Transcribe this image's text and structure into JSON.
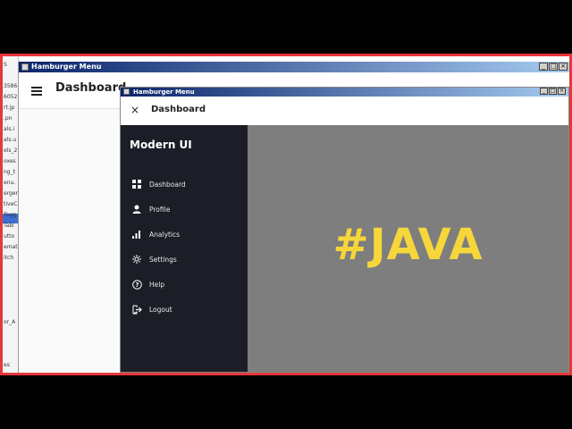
{
  "back_window": {
    "title": "Hamburger Menu",
    "header_title": "Dashboard",
    "controls": {
      "minimize": "_",
      "maximize": "□",
      "close": "×"
    }
  },
  "front_window": {
    "title": "Hamburger Menu",
    "close_glyph": "×",
    "header_title": "Dashboard",
    "controls": {
      "minimize": "_",
      "maximize": "□",
      "close": "×"
    }
  },
  "sidebar": {
    "brand": "Modern UI",
    "items": [
      {
        "label": "Dashboard",
        "icon": "dashboard-grid-icon"
      },
      {
        "label": "Profile",
        "icon": "user-icon"
      },
      {
        "label": "Analytics",
        "icon": "bar-chart-icon"
      },
      {
        "label": "Settings",
        "icon": "gear-icon"
      },
      {
        "label": "Help",
        "icon": "help-circle-icon"
      },
      {
        "label": "Logout",
        "icon": "logout-icon"
      }
    ]
  },
  "content": {
    "hero_text": "#JAVA",
    "background_color": "#7e7e7e",
    "hero_color": "#f6d63b"
  },
  "editor_strip": {
    "lines": [
      "S",
      "",
      "3586",
      "6052",
      "rt.jp",
      ".pn",
      "als.i",
      "als.u",
      "els_2",
      "oxes",
      "ng_t",
      "enu.",
      "ergerf",
      "tiveC",
      "Togg",
      "Tabl",
      "utto",
      "emati",
      "itch",
      "",
      "",
      "",
      "",
      "",
      "or_A",
      "",
      "",
      "",
      "es"
    ]
  },
  "colors": {
    "frame_border": "#e8363a",
    "sidebar_bg": "#1c1e27"
  }
}
